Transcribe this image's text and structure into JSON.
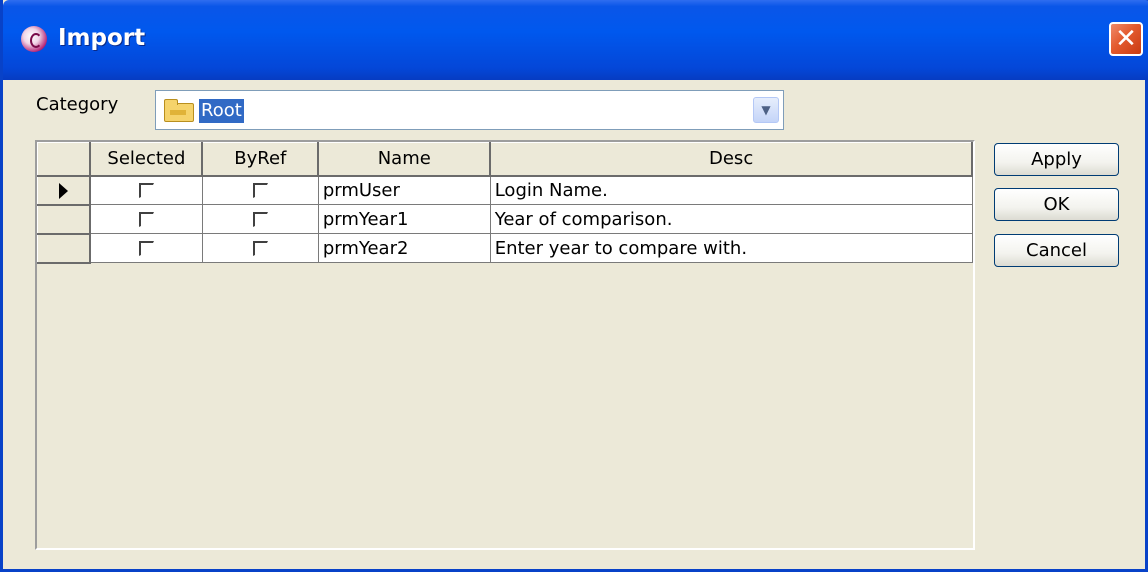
{
  "window": {
    "title": "Import",
    "close_label": "✕"
  },
  "category": {
    "label": "Category",
    "value": "Root"
  },
  "grid": {
    "columns": [
      "Selected",
      "ByRef",
      "Name",
      "Desc"
    ],
    "rows": [
      {
        "name": "prmUser",
        "desc": "Login Name.",
        "selected": false,
        "byref": false,
        "current": true
      },
      {
        "name": "prmYear1",
        "desc": "Year of comparison.",
        "selected": false,
        "byref": false,
        "current": false
      },
      {
        "name": "prmYear2",
        "desc": "Enter year to compare with.",
        "selected": false,
        "byref": false,
        "current": false
      }
    ]
  },
  "buttons": {
    "apply": "Apply",
    "ok": "OK",
    "cancel": "Cancel"
  }
}
